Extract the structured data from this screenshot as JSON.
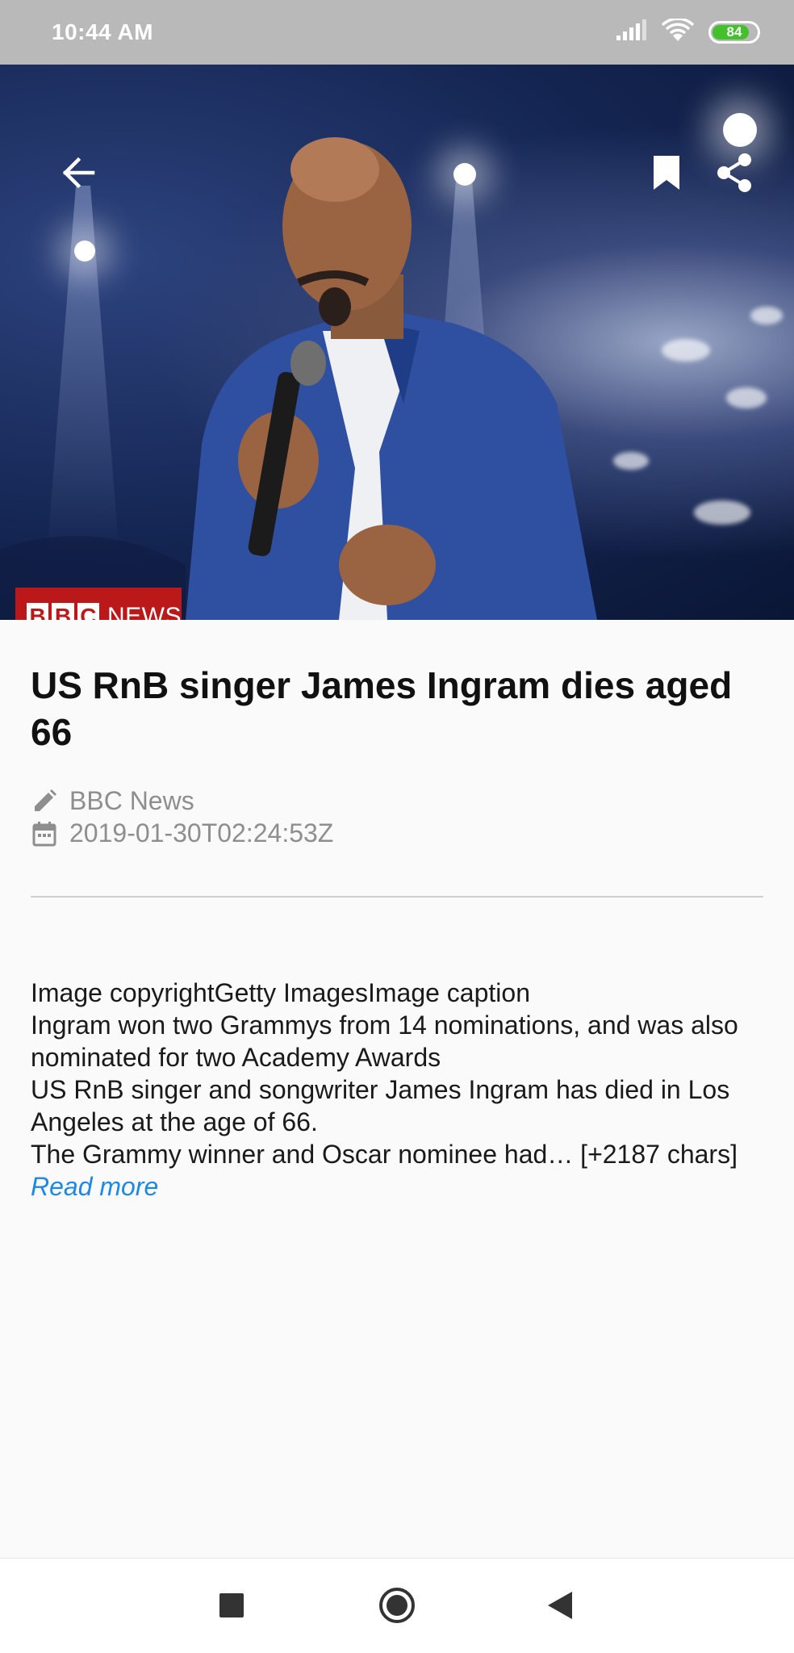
{
  "status_bar": {
    "time": "10:44 AM",
    "battery_level": "84",
    "battery_fraction": 0.84,
    "battery_color": "#44c02c"
  },
  "hero": {
    "logo_blocks": [
      "B",
      "B",
      "C"
    ],
    "logo_word": "NEWS",
    "logo_color": "#bb1919",
    "icons": [
      "arrow-left-icon",
      "bookmark-icon",
      "share-icon"
    ]
  },
  "article": {
    "title": "US RnB singer James Ingram dies aged 66",
    "author": "BBC News",
    "published": "2019-01-30T02:24:53Z",
    "body": "Image copyrightGetty ImagesImage caption\n Ingram won two Grammys from 14 nominations, and was also nominated for two Academy Awards\nUS RnB singer and songwriter James Ingram has died in Los Angeles at the age of 66.\nThe Grammy winner and Oscar nominee had… [+2187 chars]",
    "read_more": "Read more",
    "link_color": "#1e88e5"
  },
  "nav_bar": {
    "icons": [
      "recent-apps-icon",
      "home-icon",
      "back-icon"
    ]
  }
}
